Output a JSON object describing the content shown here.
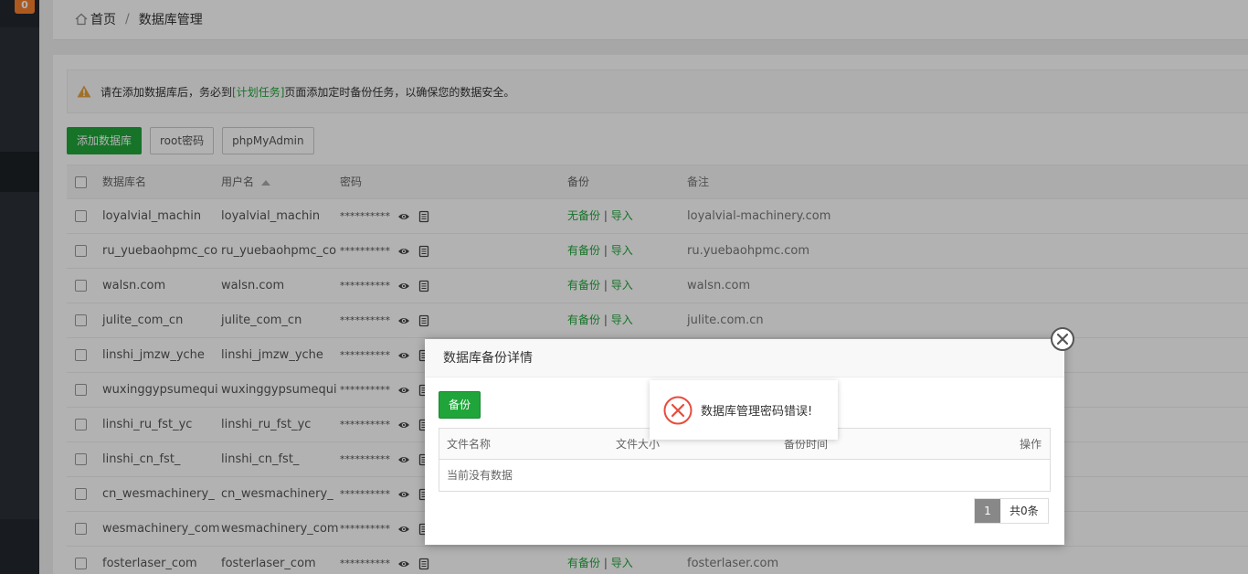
{
  "sidebar": {
    "badge": "0"
  },
  "breadcrumb": {
    "home": "首页",
    "separator": "/",
    "current": "数据库管理"
  },
  "notice": {
    "prefix": "请在添加数据库后，务必到",
    "link": "[计划任务]",
    "suffix": "页面添加定时备份任务，以确保您的数据安全。"
  },
  "toolbar": {
    "add": "添加数据库",
    "root": "root密码",
    "pma": "phpMyAdmin"
  },
  "table": {
    "headers": {
      "name": "数据库名",
      "user": "用户名",
      "password": "密码",
      "backup": "备份",
      "note": "备注"
    },
    "rows": [
      {
        "name": "loyalvial_machin",
        "user": "loyalvial_machin",
        "password": "**********",
        "backup": "无备份",
        "import": "导入",
        "note": "loyalvial-machinery.com"
      },
      {
        "name": "ru_yuebaohpmc_co",
        "user": "ru_yuebaohpmc_co",
        "password": "**********",
        "backup": "有备份",
        "import": "导入",
        "note": "ru.yuebaohpmc.com"
      },
      {
        "name": "walsn.com",
        "user": "walsn.com",
        "password": "**********",
        "backup": "有备份",
        "import": "导入",
        "note": "walsn.com"
      },
      {
        "name": "julite_com_cn",
        "user": "julite_com_cn",
        "password": "**********",
        "backup": "有备份",
        "import": "导入",
        "note": "julite.com.cn"
      },
      {
        "name": "linshi_jmzw_yche",
        "user": "linshi_jmzw_yche",
        "password": "**********",
        "backup": "",
        "import": "",
        "note": ""
      },
      {
        "name": "wuxinggypsumequi",
        "user": "wuxinggypsumequi",
        "password": "**********",
        "backup": "",
        "import": "",
        "note": ""
      },
      {
        "name": "linshi_ru_fst_yc",
        "user": "linshi_ru_fst_yc",
        "password": "**********",
        "backup": "",
        "import": "",
        "note": ""
      },
      {
        "name": "linshi_cn_fst_",
        "user": "linshi_cn_fst_",
        "password": "**********",
        "backup": "",
        "import": "",
        "note": ""
      },
      {
        "name": "cn_wesmachinery_",
        "user": "cn_wesmachinery_",
        "password": "**********",
        "backup": "",
        "import": "",
        "note": ""
      },
      {
        "name": "wesmachinery_com",
        "user": "wesmachinery_com",
        "password": "**********",
        "backup": "",
        "import": "",
        "note": ""
      },
      {
        "name": "fosterlaser_com",
        "user": "fosterlaser_com",
        "password": "**********",
        "backup": "有备份",
        "import": "导入",
        "note": "fosterlaser.com"
      }
    ]
  },
  "dialog": {
    "title": "数据库备份详情",
    "backup_button": "备份",
    "columns": {
      "file": "文件名称",
      "size": "文件大小",
      "time": "备份时间",
      "action": "操作"
    },
    "empty": "当前没有数据",
    "pager": {
      "current": "1",
      "total": "共0条"
    }
  },
  "toast": {
    "message": "数据库管理密码错误!"
  },
  "colors": {
    "accent": "#20a53a",
    "sidebar": "#2c3138",
    "badge": "#f7802f",
    "error": "#e74c3c"
  }
}
